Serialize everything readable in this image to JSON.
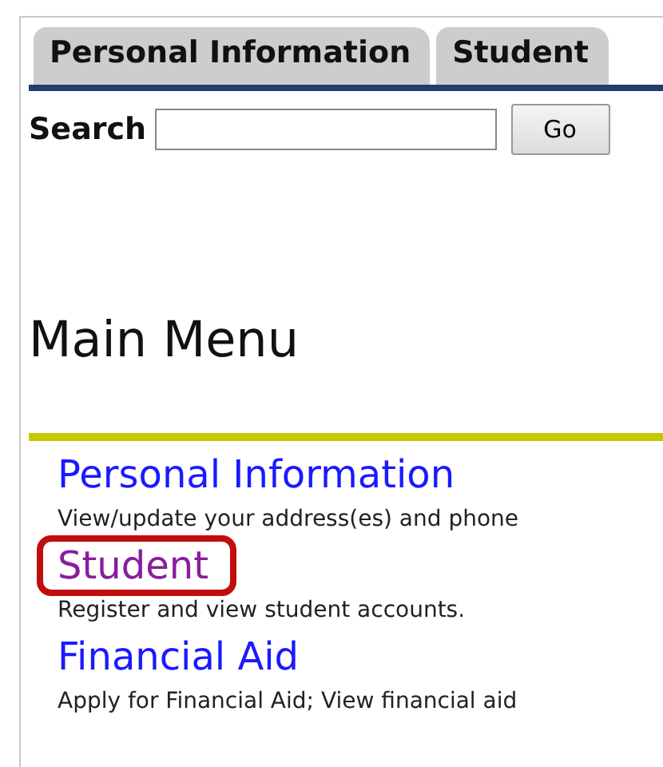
{
  "tabs": [
    {
      "label": "Personal Information"
    },
    {
      "label": "Student"
    }
  ],
  "search": {
    "label": "Search",
    "button": "Go"
  },
  "heading": "Main Menu",
  "menu": [
    {
      "title": "Personal Information",
      "description": "View/update your address(es) and phone",
      "visited": false,
      "highlighted": false
    },
    {
      "title": "Student",
      "description": "Register and view student accounts.",
      "visited": true,
      "highlighted": true
    },
    {
      "title": "Financial Aid",
      "description": "Apply for Financial Aid; View financial aid",
      "visited": false,
      "highlighted": false
    }
  ]
}
